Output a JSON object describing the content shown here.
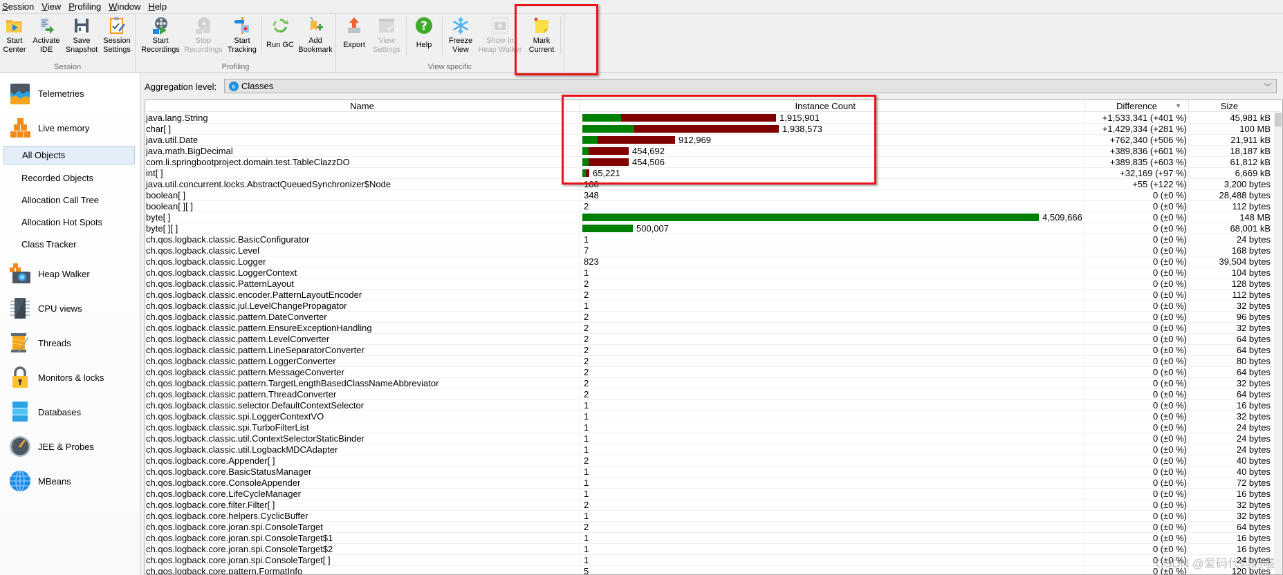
{
  "menu": [
    {
      "label": "Session",
      "accel": "S"
    },
    {
      "label": "View",
      "accel": "V"
    },
    {
      "label": "Profiling",
      "accel": "P"
    },
    {
      "label": "Window",
      "accel": "W"
    },
    {
      "label": "Help",
      "accel": "H"
    }
  ],
  "toolbar": {
    "groups": {
      "session": "Session",
      "profiling": "Profiling",
      "view_specific": "View specific"
    },
    "buttons": {
      "start_center": "Start\nCenter",
      "activate_ide": "Activate\nIDE",
      "save_snapshot": "Save\nSnapshot",
      "session_settings": "Session\nSettings",
      "start_recordings": "Start\nRecordings",
      "stop_recordings": "Stop\nRecordings",
      "start_tracking": "Start\nTracking",
      "run_gc": "Run GC",
      "add_bookmark": "Add\nBookmark",
      "export": "Export",
      "view_settings": "View\nSettings",
      "help": "Help",
      "freeze_view": "Freeze\nView",
      "show_in_heap_walker": "Show In\nHeap Walker",
      "mark_current": "Mark\nCurrent"
    }
  },
  "sidebar": {
    "sections": [
      {
        "label": "Telemetries",
        "icon": "telemetries-icon"
      },
      {
        "label": "Live memory",
        "icon": "live-memory-icon"
      },
      {
        "label": "Heap Walker",
        "icon": "heap-walker-icon"
      },
      {
        "label": "CPU views",
        "icon": "cpu-icon"
      },
      {
        "label": "Threads",
        "icon": "threads-icon"
      },
      {
        "label": "Monitors & locks",
        "icon": "lock-icon"
      },
      {
        "label": "Databases",
        "icon": "database-icon"
      },
      {
        "label": "JEE & Probes",
        "icon": "gauge-icon"
      },
      {
        "label": "MBeans",
        "icon": "globe-icon"
      }
    ],
    "live_memory_items": [
      {
        "label": "All Objects",
        "selected": true
      },
      {
        "label": "Recorded Objects"
      },
      {
        "label": "Allocation Call Tree"
      },
      {
        "label": "Allocation Hot Spots"
      },
      {
        "label": "Class Tracker"
      }
    ]
  },
  "main": {
    "aggregation_label": "Aggregation level:",
    "aggregation_value": "Classes",
    "columns": {
      "name": "Name",
      "count": "Instance Count",
      "diff": "Difference",
      "size": "Size"
    },
    "sort_column": "Difference",
    "sort_direction": "descending",
    "colors": {
      "baseline_bar": "#008000",
      "increase_bar": "#800000"
    },
    "rows": [
      {
        "name": "java.lang.String",
        "count": "1,915,901",
        "count_n": 1915901,
        "diff_n": 1533341,
        "diff": "+1,533,341 (+401 %)",
        "size": "45,981 kB"
      },
      {
        "name": "char[ ]",
        "count": "1,938,573",
        "count_n": 1938573,
        "diff_n": 1429334,
        "diff": "+1,429,334 (+281 %)",
        "size": "100 MB"
      },
      {
        "name": "java.util.Date",
        "count": "912,969",
        "count_n": 912969,
        "diff_n": 762340,
        "diff": "+762,340 (+506 %)",
        "size": "21,911 kB"
      },
      {
        "name": "java.math.BigDecimal",
        "count": "454,692",
        "count_n": 454692,
        "diff_n": 389836,
        "diff": "+389,836 (+601 %)",
        "size": "18,187 kB"
      },
      {
        "name": "com.li.springbootproject.domain.test.TableClazzDO",
        "count": "454,506",
        "count_n": 454506,
        "diff_n": 389835,
        "diff": "+389,835 (+603 %)",
        "size": "61,812 kB"
      },
      {
        "name": "int[ ]",
        "count": "65,221",
        "count_n": 65221,
        "diff_n": 32169,
        "diff": "+32,169 (+97 %)",
        "size": "6,669 kB"
      },
      {
        "name": "java.util.concurrent.locks.AbstractQueuedSynchronizer$Node",
        "count": "100",
        "count_n": 100,
        "diff_n": 55,
        "diff": "+55 (+122 %)",
        "size": "3,200 bytes"
      },
      {
        "name": "boolean[ ]",
        "count": "348",
        "count_n": 348,
        "diff_n": 0,
        "diff": "0 (±0 %)",
        "size": "28,488 bytes"
      },
      {
        "name": "boolean[ ][ ]",
        "count": "2",
        "count_n": 2,
        "diff_n": 0,
        "diff": "0 (±0 %)",
        "size": "112 bytes"
      },
      {
        "name": "byte[ ]",
        "count": "4,509,666",
        "count_n": 4509666,
        "diff_n": 0,
        "diff": "0 (±0 %)",
        "size": "148 MB"
      },
      {
        "name": "byte[ ][ ]",
        "count": "500,007",
        "count_n": 500007,
        "diff_n": 0,
        "diff": "0 (±0 %)",
        "size": "68,001 kB"
      },
      {
        "name": "ch.qos.logback.classic.BasicConfigurator",
        "count": "1",
        "count_n": 1,
        "diff_n": 0,
        "diff": "0 (±0 %)",
        "size": "24 bytes"
      },
      {
        "name": "ch.qos.logback.classic.Level",
        "count": "7",
        "count_n": 7,
        "diff_n": 0,
        "diff": "0 (±0 %)",
        "size": "168 bytes"
      },
      {
        "name": "ch.qos.logback.classic.Logger",
        "count": "823",
        "count_n": 823,
        "diff_n": 0,
        "diff": "0 (±0 %)",
        "size": "39,504 bytes"
      },
      {
        "name": "ch.qos.logback.classic.LoggerContext",
        "count": "1",
        "count_n": 1,
        "diff_n": 0,
        "diff": "0 (±0 %)",
        "size": "104 bytes"
      },
      {
        "name": "ch.qos.logback.classic.PatternLayout",
        "count": "2",
        "count_n": 2,
        "diff_n": 0,
        "diff": "0 (±0 %)",
        "size": "128 bytes"
      },
      {
        "name": "ch.qos.logback.classic.encoder.PatternLayoutEncoder",
        "count": "2",
        "count_n": 2,
        "diff_n": 0,
        "diff": "0 (±0 %)",
        "size": "112 bytes"
      },
      {
        "name": "ch.qos.logback.classic.jul.LevelChangePropagator",
        "count": "1",
        "count_n": 1,
        "diff_n": 0,
        "diff": "0 (±0 %)",
        "size": "32 bytes"
      },
      {
        "name": "ch.qos.logback.classic.pattern.DateConverter",
        "count": "2",
        "count_n": 2,
        "diff_n": 0,
        "diff": "0 (±0 %)",
        "size": "96 bytes"
      },
      {
        "name": "ch.qos.logback.classic.pattern.EnsureExceptionHandling",
        "count": "2",
        "count_n": 2,
        "diff_n": 0,
        "diff": "0 (±0 %)",
        "size": "32 bytes"
      },
      {
        "name": "ch.qos.logback.classic.pattern.LevelConverter",
        "count": "2",
        "count_n": 2,
        "diff_n": 0,
        "diff": "0 (±0 %)",
        "size": "64 bytes"
      },
      {
        "name": "ch.qos.logback.classic.pattern.LineSeparatorConverter",
        "count": "2",
        "count_n": 2,
        "diff_n": 0,
        "diff": "0 (±0 %)",
        "size": "64 bytes"
      },
      {
        "name": "ch.qos.logback.classic.pattern.LoggerConverter",
        "count": "2",
        "count_n": 2,
        "diff_n": 0,
        "diff": "0 (±0 %)",
        "size": "80 bytes"
      },
      {
        "name": "ch.qos.logback.classic.pattern.MessageConverter",
        "count": "2",
        "count_n": 2,
        "diff_n": 0,
        "diff": "0 (±0 %)",
        "size": "64 bytes"
      },
      {
        "name": "ch.qos.logback.classic.pattern.TargetLengthBasedClassNameAbbreviator",
        "count": "2",
        "count_n": 2,
        "diff_n": 0,
        "diff": "0 (±0 %)",
        "size": "32 bytes"
      },
      {
        "name": "ch.qos.logback.classic.pattern.ThreadConverter",
        "count": "2",
        "count_n": 2,
        "diff_n": 0,
        "diff": "0 (±0 %)",
        "size": "64 bytes"
      },
      {
        "name": "ch.qos.logback.classic.selector.DefaultContextSelector",
        "count": "1",
        "count_n": 1,
        "diff_n": 0,
        "diff": "0 (±0 %)",
        "size": "16 bytes"
      },
      {
        "name": "ch.qos.logback.classic.spi.LoggerContextVO",
        "count": "1",
        "count_n": 1,
        "diff_n": 0,
        "diff": "0 (±0 %)",
        "size": "32 bytes"
      },
      {
        "name": "ch.qos.logback.classic.spi.TurboFilterList",
        "count": "1",
        "count_n": 1,
        "diff_n": 0,
        "diff": "0 (±0 %)",
        "size": "24 bytes"
      },
      {
        "name": "ch.qos.logback.classic.util.ContextSelectorStaticBinder",
        "count": "1",
        "count_n": 1,
        "diff_n": 0,
        "diff": "0 (±0 %)",
        "size": "24 bytes"
      },
      {
        "name": "ch.qos.logback.classic.util.LogbackMDCAdapter",
        "count": "1",
        "count_n": 1,
        "diff_n": 0,
        "diff": "0 (±0 %)",
        "size": "24 bytes"
      },
      {
        "name": "ch.qos.logback.core.Appender[ ]",
        "count": "2",
        "count_n": 2,
        "diff_n": 0,
        "diff": "0 (±0 %)",
        "size": "40 bytes"
      },
      {
        "name": "ch.qos.logback.core.BasicStatusManager",
        "count": "1",
        "count_n": 1,
        "diff_n": 0,
        "diff": "0 (±0 %)",
        "size": "40 bytes"
      },
      {
        "name": "ch.qos.logback.core.ConsoleAppender",
        "count": "1",
        "count_n": 1,
        "diff_n": 0,
        "diff": "0 (±0 %)",
        "size": "72 bytes"
      },
      {
        "name": "ch.qos.logback.core.LifeCycleManager",
        "count": "1",
        "count_n": 1,
        "diff_n": 0,
        "diff": "0 (±0 %)",
        "size": "16 bytes"
      },
      {
        "name": "ch.qos.logback.core.filter.Filter[ ]",
        "count": "2",
        "count_n": 2,
        "diff_n": 0,
        "diff": "0 (±0 %)",
        "size": "32 bytes"
      },
      {
        "name": "ch.qos.logback.core.helpers.CyclicBuffer",
        "count": "1",
        "count_n": 1,
        "diff_n": 0,
        "diff": "0 (±0 %)",
        "size": "32 bytes"
      },
      {
        "name": "ch.qos.logback.core.joran.spi.ConsoleTarget",
        "count": "2",
        "count_n": 2,
        "diff_n": 0,
        "diff": "0 (±0 %)",
        "size": "64 bytes"
      },
      {
        "name": "ch.qos.logback.core.joran.spi.ConsoleTarget$1",
        "count": "1",
        "count_n": 1,
        "diff_n": 0,
        "diff": "0 (±0 %)",
        "size": "16 bytes"
      },
      {
        "name": "ch.qos.logback.core.joran.spi.ConsoleTarget$2",
        "count": "1",
        "count_n": 1,
        "diff_n": 0,
        "diff": "0 (±0 %)",
        "size": "16 bytes"
      },
      {
        "name": "ch.qos.logback.core.joran.spi.ConsoleTarget[ ]",
        "count": "1",
        "count_n": 1,
        "diff_n": 0,
        "diff": "0 (±0 %)",
        "size": "24 bytes"
      },
      {
        "name": "ch.qos.logback.core.pattern.FormatInfo",
        "count": "5",
        "count_n": 5,
        "diff_n": 0,
        "diff": "0 (±0 %)",
        "size": "120 bytes"
      }
    ]
  },
  "watermark": "CSDN @爱码代码的喵"
}
